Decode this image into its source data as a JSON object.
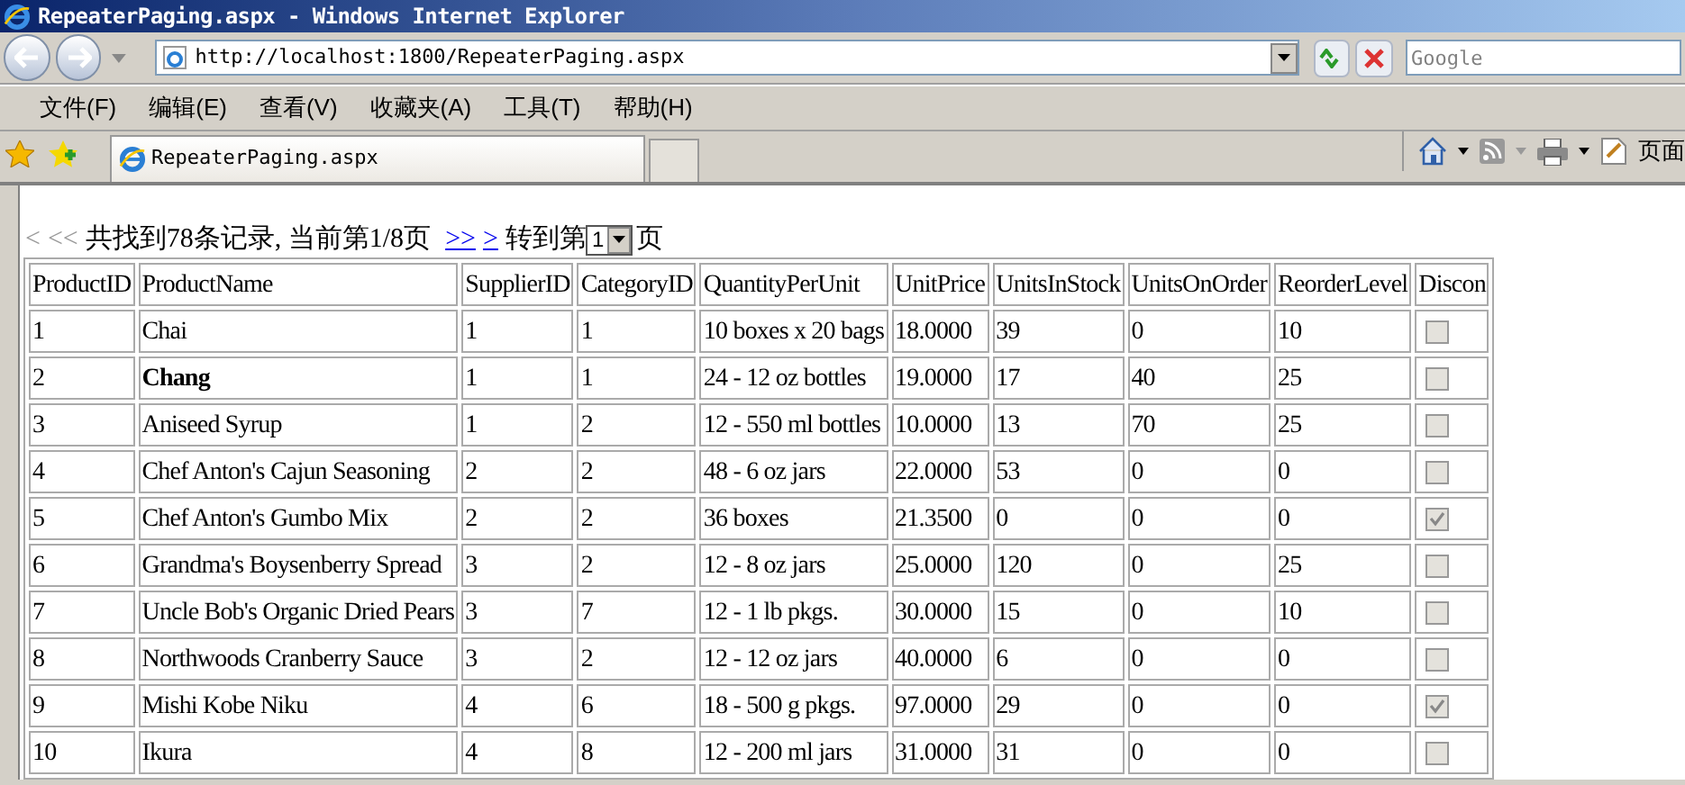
{
  "window": {
    "title": "RepeaterPaging.aspx - Windows Internet Explorer"
  },
  "address_bar": {
    "value": "http://localhost:1800/RepeaterPaging.aspx"
  },
  "search": {
    "placeholder": "Google"
  },
  "menu": [
    "文件(F)",
    "编辑(E)",
    "查看(V)",
    "收藏夹(A)",
    "工具(T)",
    "帮助(H)"
  ],
  "tab": {
    "label": "RepeaterPaging.aspx"
  },
  "toolbar": {
    "page_label": "页面"
  },
  "pager": {
    "prev_links": [
      {
        "label": "<",
        "disabled": true
      },
      {
        "label": "<<",
        "disabled": true
      }
    ],
    "summary": "共找到78条记录, 当前第1/8页",
    "next_links": [
      {
        "label": ">>",
        "disabled": false
      },
      {
        "label": ">",
        "disabled": false
      }
    ],
    "goto_label": "转到第",
    "page_select": "1",
    "page_suffix": "页"
  },
  "table": {
    "columns": [
      "ProductID",
      "ProductName",
      "SupplierID",
      "CategoryID",
      "QuantityPerUnit",
      "UnitPrice",
      "UnitsInStock",
      "UnitsOnOrder",
      "ReorderLevel",
      "Discon"
    ],
    "rows": [
      {
        "cells": [
          "1",
          "Chai",
          "1",
          "1",
          "10 boxes x 20 bags",
          "18.0000",
          "39",
          "0",
          "10"
        ],
        "bold": false,
        "discontinued": false
      },
      {
        "cells": [
          "2",
          "Chang",
          "1",
          "1",
          "24 - 12 oz bottles",
          "19.0000",
          "17",
          "40",
          "25"
        ],
        "bold": true,
        "discontinued": false
      },
      {
        "cells": [
          "3",
          "Aniseed Syrup",
          "1",
          "2",
          "12 - 550 ml bottles",
          "10.0000",
          "13",
          "70",
          "25"
        ],
        "bold": false,
        "discontinued": false
      },
      {
        "cells": [
          "4",
          "Chef Anton's Cajun Seasoning",
          "2",
          "2",
          "48 - 6 oz jars",
          "22.0000",
          "53",
          "0",
          "0"
        ],
        "bold": false,
        "discontinued": false
      },
      {
        "cells": [
          "5",
          "Chef Anton's Gumbo Mix",
          "2",
          "2",
          "36 boxes",
          "21.3500",
          "0",
          "0",
          "0"
        ],
        "bold": false,
        "discontinued": true
      },
      {
        "cells": [
          "6",
          "Grandma's Boysenberry Spread",
          "3",
          "2",
          "12 - 8 oz jars",
          "25.0000",
          "120",
          "0",
          "25"
        ],
        "bold": false,
        "discontinued": false
      },
      {
        "cells": [
          "7",
          "Uncle Bob's Organic Dried Pears",
          "3",
          "7",
          "12 - 1 lb pkgs.",
          "30.0000",
          "15",
          "0",
          "10"
        ],
        "bold": false,
        "discontinued": false
      },
      {
        "cells": [
          "8",
          "Northwoods Cranberry Sauce",
          "3",
          "2",
          "12 - 12 oz jars",
          "40.0000",
          "6",
          "0",
          "0"
        ],
        "bold": false,
        "discontinued": false
      },
      {
        "cells": [
          "9",
          "Mishi Kobe Niku",
          "4",
          "6",
          "18 - 500 g pkgs.",
          "97.0000",
          "29",
          "0",
          "0"
        ],
        "bold": false,
        "discontinued": true
      },
      {
        "cells": [
          "10",
          "Ikura",
          "4",
          "8",
          "12 - 200 ml jars",
          "31.0000",
          "31",
          "0",
          "0"
        ],
        "bold": false,
        "discontinued": false
      }
    ]
  }
}
